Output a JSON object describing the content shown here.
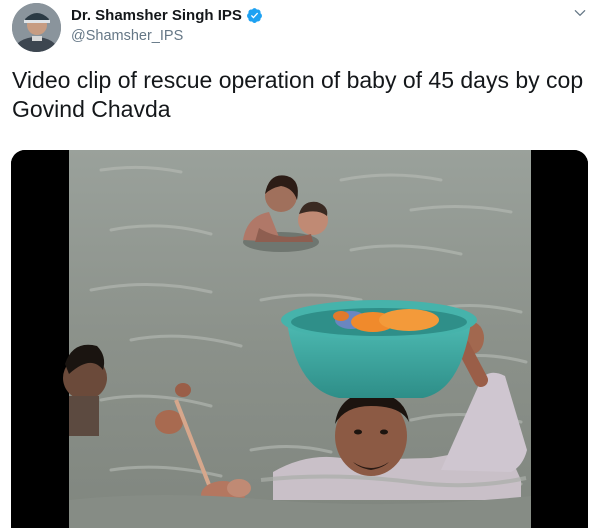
{
  "author": {
    "display_name": "Dr. Shamsher Singh IPS",
    "handle": "@Shamsher_IPS",
    "verified": true
  },
  "tweet": {
    "text": "Video clip of rescue operation of baby of 45 days by cop\nGovind Chavda"
  },
  "colors": {
    "verified_blue": "#1da1f2",
    "name_text": "#14171a",
    "handle_text": "#657786",
    "water": "#8f958f",
    "tub": "#3aa7a0"
  }
}
